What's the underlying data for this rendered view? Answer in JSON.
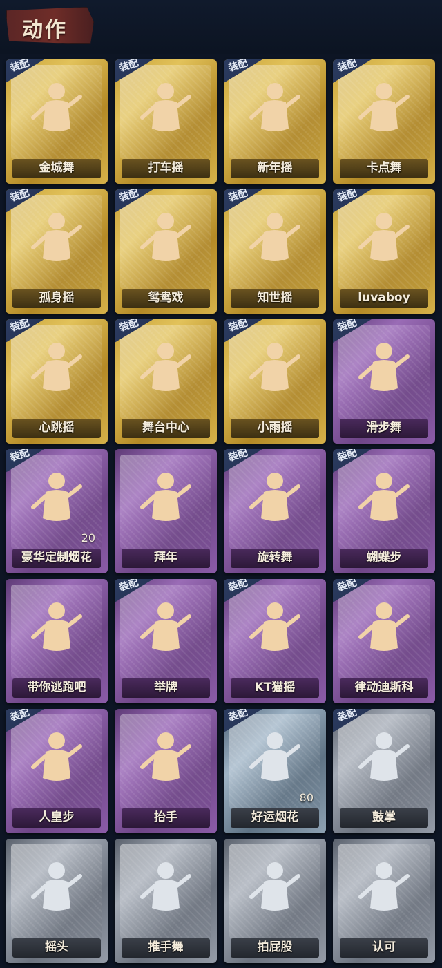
{
  "header": {
    "title": "动作"
  },
  "badge_text": "装配",
  "colors": {
    "gold": "#d1b04a",
    "purple": "#8a5ca7",
    "silver": "#9aa1ad",
    "blue": "#8ea2b4",
    "background": "#0d1524"
  },
  "cards": [
    {
      "label": "金城舞",
      "tier": "gold",
      "equipped": true,
      "icon": "pose-dance-icon"
    },
    {
      "label": "打车摇",
      "tier": "gold",
      "equipped": true,
      "icon": "pose-dance-icon"
    },
    {
      "label": "新年摇",
      "tier": "gold",
      "equipped": true,
      "icon": "pose-dance-icon"
    },
    {
      "label": "卡点舞",
      "tier": "gold",
      "equipped": true,
      "icon": "pose-dance-icon"
    },
    {
      "label": "孤身摇",
      "tier": "gold",
      "equipped": true,
      "icon": "pose-dance-icon"
    },
    {
      "label": "鸳鸯戏",
      "tier": "gold",
      "equipped": true,
      "icon": "pose-dance-icon"
    },
    {
      "label": "知世摇",
      "tier": "gold",
      "equipped": true,
      "icon": "pose-dance-icon"
    },
    {
      "label": "luvaboy",
      "tier": "gold",
      "equipped": true,
      "icon": "pose-dance-icon"
    },
    {
      "label": "心跳摇",
      "tier": "gold",
      "equipped": true,
      "icon": "pose-dance-icon"
    },
    {
      "label": "舞台中心",
      "tier": "gold",
      "equipped": true,
      "icon": "pose-dance-icon"
    },
    {
      "label": "小雨摇",
      "tier": "gold",
      "equipped": true,
      "icon": "pose-dance-icon"
    },
    {
      "label": "滑步舞",
      "tier": "purple",
      "equipped": true,
      "icon": "pose-dance-icon"
    },
    {
      "label": "豪华定制烟花",
      "tier": "purple",
      "equipped": true,
      "icon": "fireworks-icon",
      "count": "20"
    },
    {
      "label": "拜年",
      "tier": "purple",
      "equipped": false,
      "icon": "pose-bow-icon"
    },
    {
      "label": "旋转舞",
      "tier": "purple",
      "equipped": true,
      "icon": "pose-spin-icon"
    },
    {
      "label": "蝴蝶步",
      "tier": "purple",
      "equipped": true,
      "icon": "pose-dance-icon"
    },
    {
      "label": "带你逃跑吧",
      "tier": "purple",
      "equipped": false,
      "icon": "pose-dance-icon"
    },
    {
      "label": "举牌",
      "tier": "purple",
      "equipped": true,
      "icon": "pose-sign-icon"
    },
    {
      "label": "KT猫摇",
      "tier": "purple",
      "equipped": true,
      "icon": "pose-dance-icon"
    },
    {
      "label": "律动迪斯科",
      "tier": "purple",
      "equipped": true,
      "icon": "pose-dance-icon"
    },
    {
      "label": "人皇步",
      "tier": "purple",
      "equipped": true,
      "icon": "pose-dance-icon"
    },
    {
      "label": "抬手",
      "tier": "purple",
      "equipped": false,
      "icon": "pose-hand-icon"
    },
    {
      "label": "好运烟花",
      "tier": "blue",
      "equipped": true,
      "icon": "fireworks-can-icon",
      "count": "80"
    },
    {
      "label": "鼓掌",
      "tier": "silver",
      "equipped": true,
      "icon": "clap-icon"
    },
    {
      "label": "摇头",
      "tier": "silver",
      "equipped": false,
      "icon": "pose-shake-icon"
    },
    {
      "label": "推手舞",
      "tier": "silver",
      "equipped": false,
      "icon": "pose-push-icon"
    },
    {
      "label": "拍屁股",
      "tier": "silver",
      "equipped": false,
      "icon": "pose-slap-icon"
    },
    {
      "label": "认可",
      "tier": "silver",
      "equipped": false,
      "icon": "thumbs-up-icon"
    }
  ]
}
